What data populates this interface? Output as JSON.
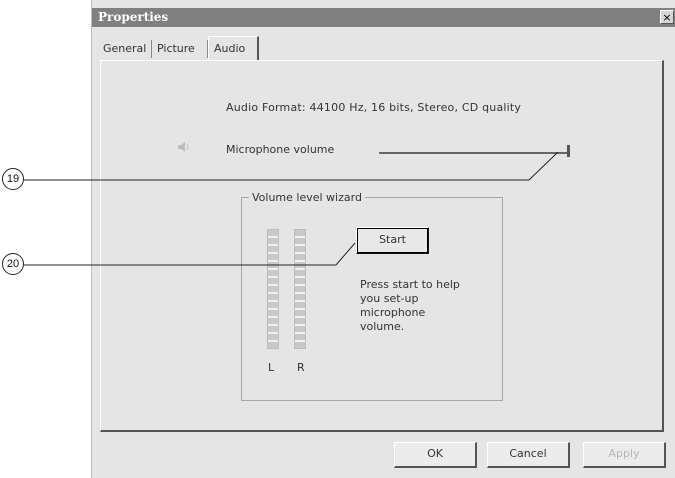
{
  "window": {
    "title": "Properties",
    "close_glyph": "×"
  },
  "tabs": [
    {
      "label": "General"
    },
    {
      "label": "Picture"
    },
    {
      "label": "Audio",
      "active": true
    }
  ],
  "audio": {
    "format_text": "Audio Format: 44100 Hz, 16 bits, Stereo, CD quality",
    "speaker_icon": "speaker-icon",
    "mic_label": "Microphone volume",
    "mic_volume_fraction": 1.0
  },
  "wizard": {
    "legend": "Volume level wizard",
    "start_label": "Start",
    "help_text": "Press start to help you set-up microphone volume.",
    "meter_left_label": "L",
    "meter_right_label": "R"
  },
  "buttons": {
    "ok_label": "OK",
    "cancel_label": "Cancel",
    "apply_label": "Apply"
  },
  "callouts": {
    "c19": "19",
    "c20": "20"
  }
}
